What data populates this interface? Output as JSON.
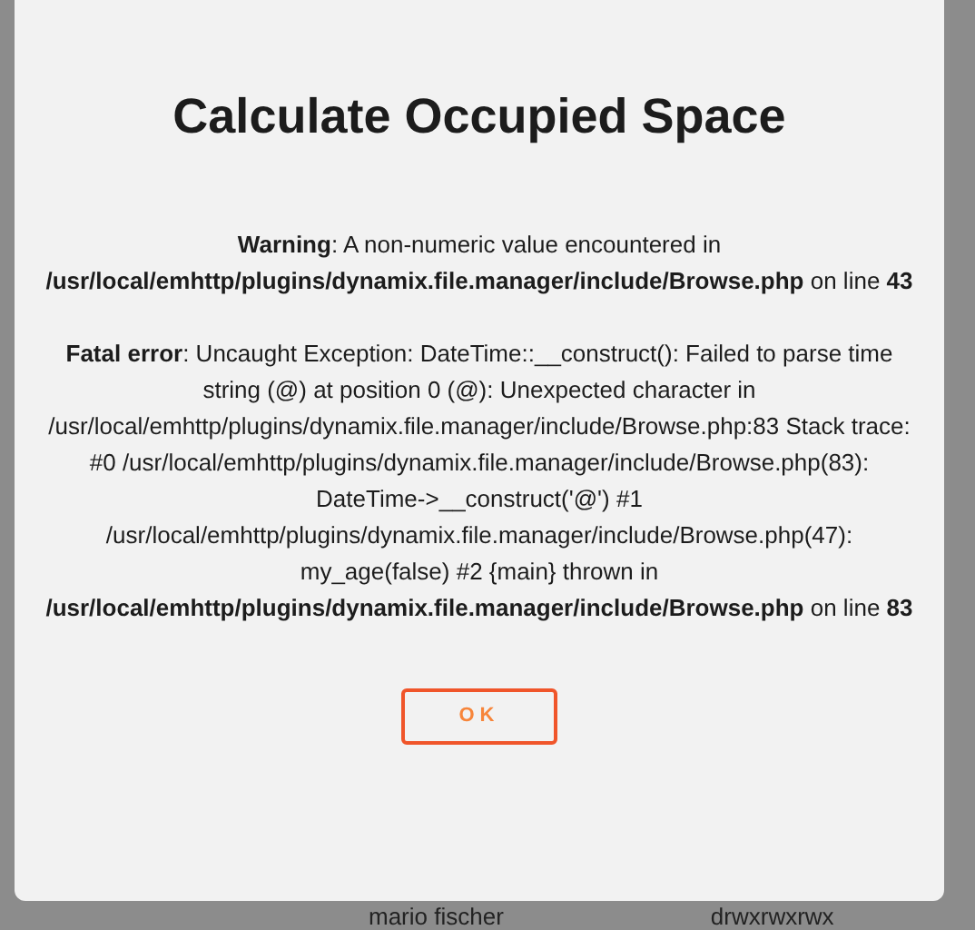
{
  "dialog": {
    "title": "Calculate Occupied Space",
    "messages": [
      "**Warning**: A non-numeric value encountered in **/usr/local/emhttp/plugins/dynamix.file.manager/include/Browse.php** on line **43**",
      "**Fatal error**: Uncaught Exception: DateTime::__construct(): Failed to parse time string (@) at position 0 (@): Unexpected character in /usr/local/emhttp/plugins/dynamix.file.manager/include/Browse.php:83 Stack trace: #0 /usr/local/emhttp/plugins/dynamix.file.manager/include/Browse.php(83): DateTime->__construct('@') #1 /usr/local/emhttp/plugins/dynamix.file.manager/include/Browse.php(47): my_age(false) #2 {main} thrown in **/usr/local/emhttp/plugins/dynamix.file.manager/include/Browse.php** on line **83**"
    ],
    "button": "OK"
  },
  "background_row": {
    "owner": "mario fischer",
    "permissions": "drwxrwxrwx"
  }
}
